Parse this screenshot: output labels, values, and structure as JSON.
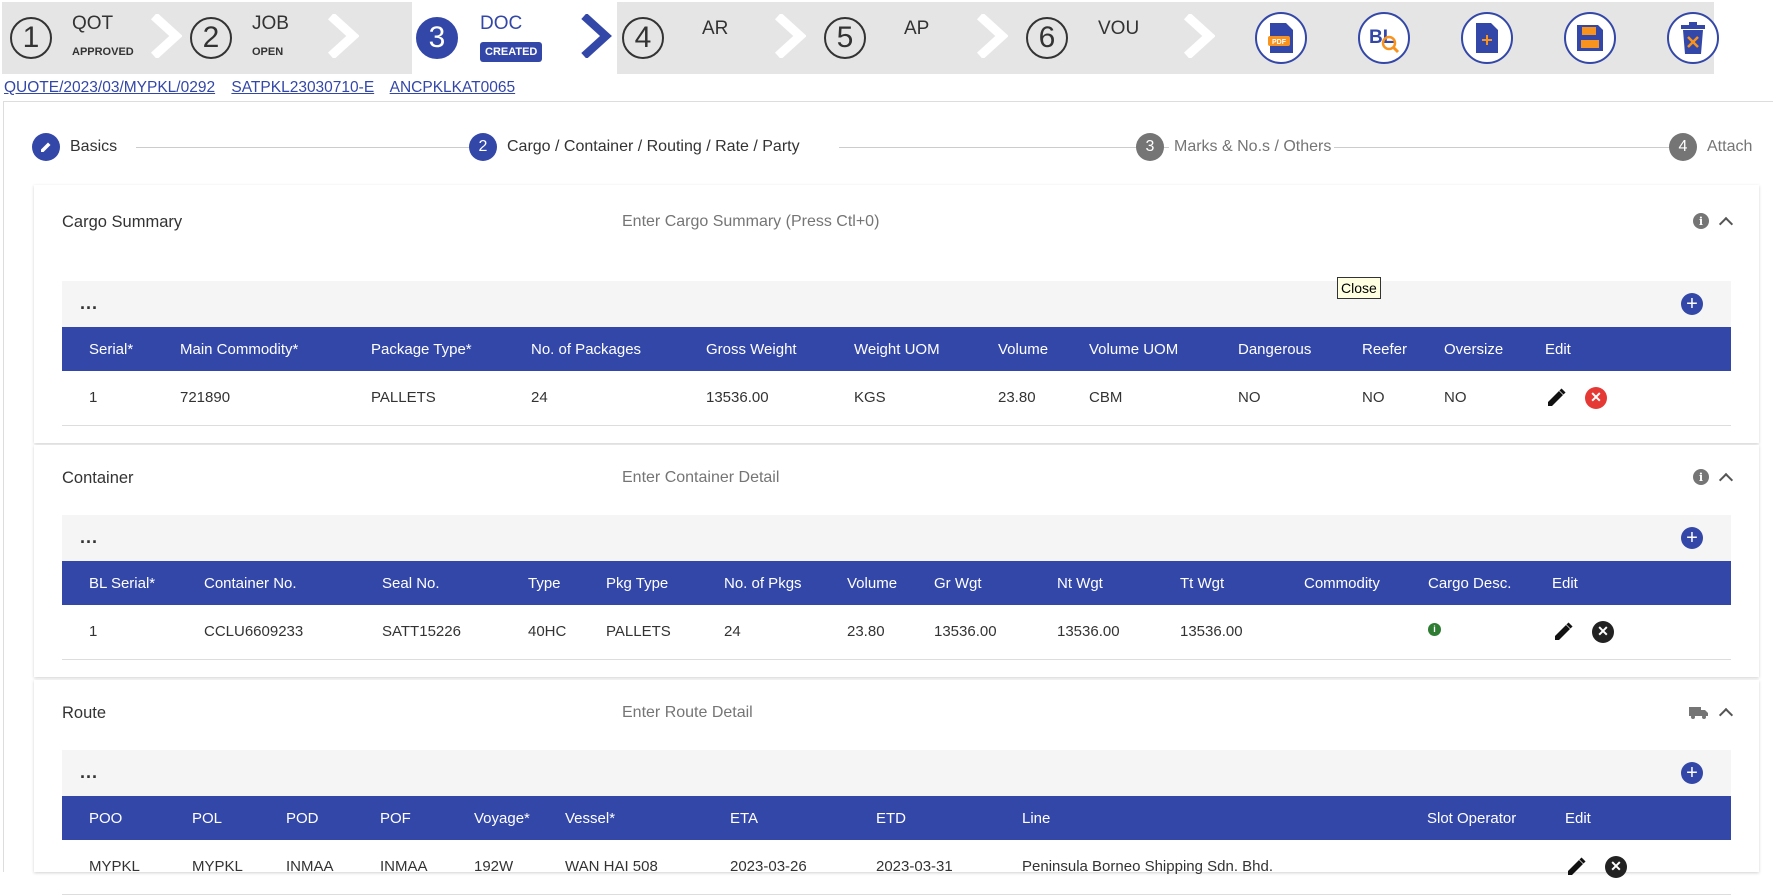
{
  "workflow": [
    {
      "num": "1",
      "label": "QOT",
      "status": "APPROVED"
    },
    {
      "num": "2",
      "label": "JOB",
      "status": "OPEN"
    },
    {
      "num": "3",
      "label": "DOC",
      "status": "CREATED"
    },
    {
      "num": "4",
      "label": "AR",
      "status": ""
    },
    {
      "num": "5",
      "label": "AP",
      "status": ""
    },
    {
      "num": "6",
      "label": "VOU",
      "status": ""
    }
  ],
  "toolbar": {
    "pdf_text": "PDF",
    "bl_text": "BL",
    "new_doc_icon": "file-plus-icon",
    "save_icon": "save-icon",
    "delete_icon": "delete-icon"
  },
  "links": [
    "QUOTE/2023/03/MYPKL/0292",
    "SATPKL23030710-E",
    "ANCPKLKAT0065"
  ],
  "stepper": [
    {
      "num": "",
      "label": "Basics"
    },
    {
      "num": "2",
      "label": "Cargo / Container / Routing / Rate / Party"
    },
    {
      "num": "3",
      "label": "Marks & No.s / Others"
    },
    {
      "num": "4",
      "label": "Attach"
    }
  ],
  "tooltip": "Close",
  "cargo": {
    "title": "Cargo Summary",
    "placeholder": "Enter Cargo Summary (Press Ctl+0)",
    "more": "...",
    "headers": [
      "Serial*",
      "Main Commodity*",
      "Package Type*",
      "No. of Packages",
      "Gross Weight",
      "Weight UOM",
      "Volume",
      "Volume UOM",
      "Dangerous",
      "Reefer",
      "Oversize",
      "Edit"
    ],
    "rows": [
      [
        "1",
        "721890",
        "PALLETS",
        "24",
        "13536.00",
        "KGS",
        "23.80",
        "CBM",
        "NO",
        "NO",
        "NO"
      ]
    ]
  },
  "container": {
    "title": "Container",
    "placeholder": "Enter Container Detail",
    "more": "...",
    "headers": [
      "BL Serial*",
      "Container No.",
      "Seal No.",
      "Type",
      "Pkg Type",
      "No. of Pkgs",
      "Volume",
      "Gr Wgt",
      "Nt Wgt",
      "Tt Wgt",
      "Commodity",
      "Cargo Desc.",
      "Edit"
    ],
    "rows": [
      [
        "1",
        "CCLU6609233",
        "SATT15226",
        "40HC",
        "PALLETS",
        "24",
        "23.80",
        "13536.00",
        "13536.00",
        "13536.00",
        ""
      ]
    ]
  },
  "route": {
    "title": "Route",
    "placeholder": "Enter Route Detail",
    "more": "...",
    "headers": [
      "POO",
      "POL",
      "POD",
      "POF",
      "Voyage*",
      "Vessel*",
      "ETA",
      "ETD",
      "Line",
      "Slot Operator",
      "Edit"
    ],
    "rows": [
      [
        "MYPKL",
        "MYPKL",
        "INMAA",
        "INMAA",
        "192W",
        "WAN HAI 508",
        "2023-03-26",
        "2023-03-31",
        "Peninsula Borneo Shipping Sdn. Bhd.",
        ""
      ]
    ]
  }
}
